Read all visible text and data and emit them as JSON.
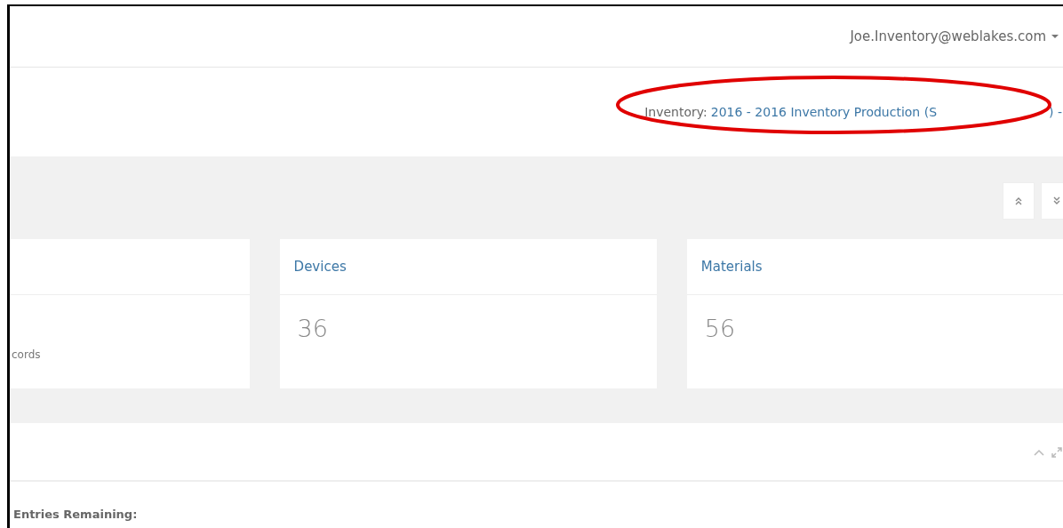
{
  "header": {
    "user_email": "Joe.Inventory@weblakes.com"
  },
  "inventory": {
    "label": "Inventory:",
    "link": "2016 - 2016 Inventory Production (S",
    "link_end": ") -"
  },
  "annotation": {
    "kind": "ellipse",
    "color": "#e00000"
  },
  "cards": [
    {
      "note": "cords"
    },
    {
      "title": "Devices",
      "value": "36"
    },
    {
      "title": "Materials",
      "value": "56"
    }
  ],
  "panel": {
    "label": "Entries Remaining:"
  }
}
